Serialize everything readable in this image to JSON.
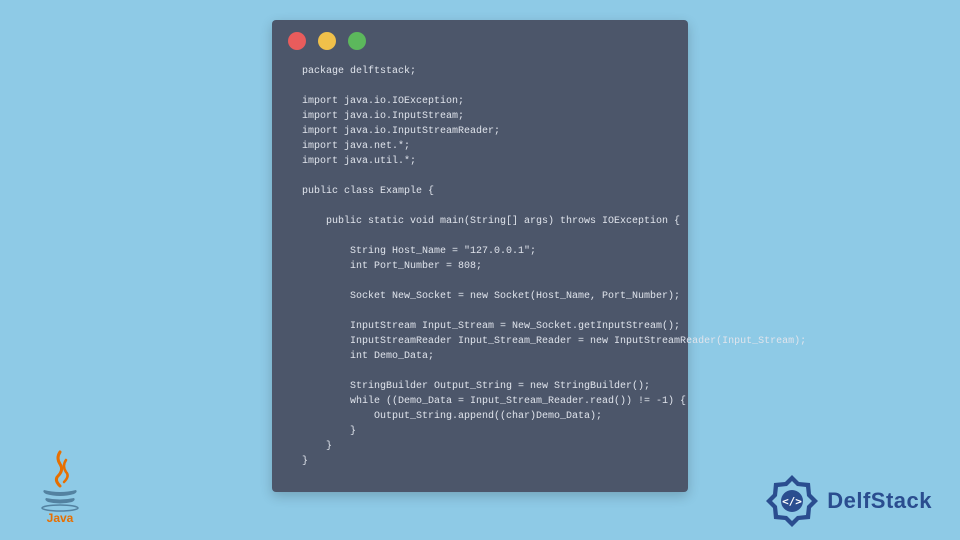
{
  "code": {
    "lines": "package delftstack;\n\nimport java.io.IOException;\nimport java.io.InputStream;\nimport java.io.InputStreamReader;\nimport java.net.*;\nimport java.util.*;\n\npublic class Example {\n\n    public static void main(String[] args) throws IOException {\n\n        String Host_Name = \"127.0.0.1\";\n        int Port_Number = 808;\n\n        Socket New_Socket = new Socket(Host_Name, Port_Number);\n\n        InputStream Input_Stream = New_Socket.getInputStream();\n        InputStreamReader Input_Stream_Reader = new InputStreamReader(Input_Stream);\n        int Demo_Data;\n\n        StringBuilder Output_String = new StringBuilder();\n        while ((Demo_Data = Input_Stream_Reader.read()) != -1) {\n            Output_String.append((char)Demo_Data);\n        }\n    }\n}"
  },
  "logos": {
    "java_label": "Java",
    "delft_label": "DelfStack"
  },
  "colors": {
    "bg": "#8ecae6",
    "window": "#4c566a",
    "red": "#e85c5c",
    "yellow": "#f0c04a",
    "green": "#5cb85c",
    "delft_blue": "#2a4d8f"
  }
}
